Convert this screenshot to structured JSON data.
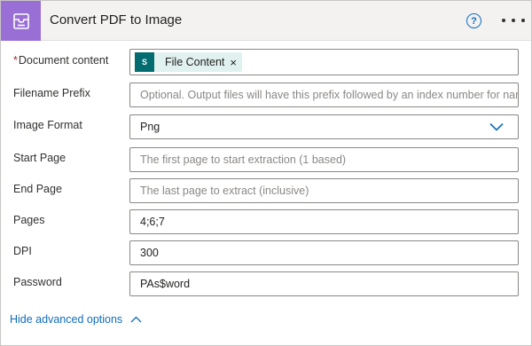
{
  "header": {
    "title": "Convert PDF to Image",
    "app_icon": "inbox-icon",
    "accent_color": "#9a6fd5",
    "help_glyph": "?",
    "more_icon": "ellipsis-icon"
  },
  "fields": {
    "document_content": {
      "required_mark": "*",
      "label": "Document content",
      "token_label": "File Content",
      "token_icon": "sharepoint-icon",
      "token_icon_text": "S",
      "token_remove": "×"
    },
    "filename_prefix": {
      "label": "Filename Prefix",
      "placeholder": "Optional. Output files will have this prefix followed by an index number for nam"
    },
    "image_format": {
      "label": "Image Format",
      "value": "Png"
    },
    "start_page": {
      "label": "Start Page",
      "placeholder": "The first page to start extraction (1 based)"
    },
    "end_page": {
      "label": "End Page",
      "placeholder": "The last page to extract (inclusive)"
    },
    "pages": {
      "label": "Pages",
      "value": "4;6;7"
    },
    "dpi": {
      "label": "DPI",
      "value": "300"
    },
    "password": {
      "label": "Password",
      "value": "PAs$word"
    }
  },
  "footer": {
    "toggle_label": "Hide advanced options"
  }
}
